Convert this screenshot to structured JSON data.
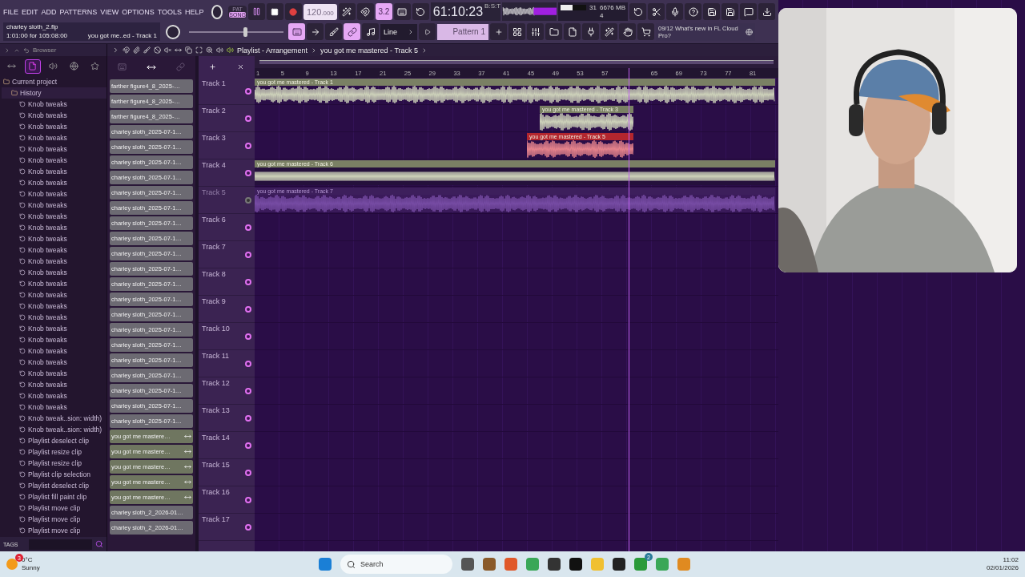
{
  "menu": [
    "FILE",
    "EDIT",
    "ADD",
    "PATTERNS",
    "VIEW",
    "OPTIONS",
    "TOOLS",
    "HELP"
  ],
  "hint": {
    "file": "charley sloth_2.flp",
    "time": "1:01:00 for 105:08:00",
    "clip": "you got me..ed - Track 1"
  },
  "mode_switch": [
    {
      "label": "PAT",
      "selected": false
    },
    {
      "label": "SONG",
      "selected": true
    }
  ],
  "tempo": {
    "value": "120",
    "decimals": ".000"
  },
  "tool_buttons_1": [
    {
      "on": false
    },
    {
      "on": false
    },
    {
      "on": true,
      "label": "3.2"
    },
    {
      "on": false
    },
    {
      "on": false
    }
  ],
  "tool_buttons_2": [
    {
      "on": true
    },
    {
      "on": false
    },
    {
      "on": false
    },
    {
      "on": true
    },
    {
      "on": false
    }
  ],
  "master": {
    "level": 0.6
  },
  "snap": "Line",
  "pattern": "Pattern 1",
  "clock": {
    "time": "61:10:23",
    "unit": "B:S:T"
  },
  "meters": {
    "cpu": "31",
    "memory": "6676 MB",
    "voices": "4",
    "level": 0.45
  },
  "news": {
    "date": "09/12",
    "text": "What's new in FL Cloud Pro?"
  },
  "browser": {
    "title": "Browser",
    "tabs": [
      {
        "selected": false
      },
      {
        "selected": true
      },
      {
        "selected": false
      },
      {
        "selected": false
      },
      {
        "selected": false
      }
    ],
    "tree": [
      {
        "label": "Current project",
        "children": [
          {
            "label": "History",
            "children": [
              {
                "label": "Knob tweaks"
              },
              {
                "label": "Knob tweaks"
              },
              {
                "label": "Knob tweaks"
              },
              {
                "label": "Knob tweaks"
              },
              {
                "label": "Knob tweaks"
              },
              {
                "label": "Knob tweaks"
              },
              {
                "label": "Knob tweaks"
              },
              {
                "label": "Knob tweaks"
              },
              {
                "label": "Knob tweaks"
              },
              {
                "label": "Knob tweaks"
              },
              {
                "label": "Knob tweaks"
              },
              {
                "label": "Knob tweaks"
              },
              {
                "label": "Knob tweaks"
              },
              {
                "label": "Knob tweaks"
              },
              {
                "label": "Knob tweaks"
              },
              {
                "label": "Knob tweaks"
              },
              {
                "label": "Knob tweaks"
              },
              {
                "label": "Knob tweaks"
              },
              {
                "label": "Knob tweaks"
              },
              {
                "label": "Knob tweaks"
              },
              {
                "label": "Knob tweaks"
              },
              {
                "label": "Knob tweaks"
              },
              {
                "label": "Knob tweaks"
              },
              {
                "label": "Knob tweaks"
              },
              {
                "label": "Knob tweaks"
              },
              {
                "label": "Knob tweaks"
              },
              {
                "label": "Knob tweaks"
              },
              {
                "label": "Knob tweaks"
              },
              {
                "label": "Knob tweak..sion: width)"
              },
              {
                "label": "Knob tweak..sion: width)"
              },
              {
                "label": "Playlist deselect clip"
              },
              {
                "label": "Playlist resize clip"
              },
              {
                "label": "Playlist resize clip"
              },
              {
                "label": "Playlist clip selection"
              },
              {
                "label": "Playlist deselect clip"
              },
              {
                "label": "Playlist fill paint clip"
              },
              {
                "label": "Playlist move clip"
              },
              {
                "label": "Playlist move clip"
              },
              {
                "label": "Playlist move clip"
              }
            ]
          }
        ]
      }
    ],
    "tags": "TAGS"
  },
  "playlist": {
    "title": "Playlist - Arrangement",
    "path": "you got me mastered - Track 5",
    "picker_tabs": [
      {
        "selected": false
      },
      {
        "selected": true
      },
      {
        "selected": false
      }
    ],
    "picker": [
      {
        "label": "farther figure4_8_2025-…",
        "kind": "sample"
      },
      {
        "label": "farther figure4_8_2025-…",
        "kind": "sample"
      },
      {
        "label": "farther figure4_8_2025-…",
        "kind": "sample"
      },
      {
        "label": "charley sloth_2025-07-1…",
        "kind": "sample"
      },
      {
        "label": "charley sloth_2025-07-1…",
        "kind": "sample"
      },
      {
        "label": "charley sloth_2025-07-1…",
        "kind": "sample"
      },
      {
        "label": "charley sloth_2025-07-1…",
        "kind": "sample"
      },
      {
        "label": "charley sloth_2025-07-1…",
        "kind": "sample"
      },
      {
        "label": "charley sloth_2025-07-1…",
        "kind": "sample"
      },
      {
        "label": "charley sloth_2025-07-1…",
        "kind": "sample"
      },
      {
        "label": "charley sloth_2025-07-1…",
        "kind": "sample"
      },
      {
        "label": "charley sloth_2025-07-1…",
        "kind": "sample"
      },
      {
        "label": "charley sloth_2025-07-1…",
        "kind": "sample"
      },
      {
        "label": "charley sloth_2025-07-1…",
        "kind": "sample"
      },
      {
        "label": "charley sloth_2025-07-1…",
        "kind": "sample"
      },
      {
        "label": "charley sloth_2025-07-1…",
        "kind": "sample"
      },
      {
        "label": "charley sloth_2025-07-1…",
        "kind": "sample"
      },
      {
        "label": "charley sloth_2025-07-1…",
        "kind": "sample"
      },
      {
        "label": "charley sloth_2025-07-1…",
        "kind": "sample"
      },
      {
        "label": "charley sloth_2025-07-1…",
        "kind": "sample"
      },
      {
        "label": "charley sloth_2025-07-1…",
        "kind": "sample"
      },
      {
        "label": "charley sloth_2025-07-1…",
        "kind": "sample"
      },
      {
        "label": "charley sloth_2025-07-1…",
        "kind": "sample"
      },
      {
        "label": "you got me mastere…",
        "kind": "clip"
      },
      {
        "label": "you got me mastere…",
        "kind": "clip"
      },
      {
        "label": "you got me mastere…",
        "kind": "clip"
      },
      {
        "label": "you got me mastere…",
        "kind": "clip"
      },
      {
        "label": "you got me mastere…",
        "kind": "clip"
      },
      {
        "label": "charley sloth_2_2026-01…",
        "kind": "sample"
      },
      {
        "label": "charley sloth_2_2026-01…",
        "kind": "sample"
      }
    ],
    "ruler": [
      "1",
      "5",
      "9",
      "13",
      "17",
      "21",
      "25",
      "29",
      "33",
      "37",
      "41",
      "45",
      "49",
      "53",
      "57",
      "65",
      "69",
      "73",
      "77",
      "81"
    ],
    "tracks": [
      {
        "label": "Track 1",
        "enabled": true,
        "clips": [
          {
            "label": "you got me mastered - Track 1",
            "color": "#7a8064",
            "muted": false
          }
        ]
      },
      {
        "label": "Track 2",
        "enabled": true,
        "clips": [
          {
            "label": "you got me mastered - Track 3",
            "color": "#7a8064",
            "muted": false
          }
        ]
      },
      {
        "label": "Track 3",
        "enabled": true,
        "clips": [
          {
            "label": "you got me mastered - Track 5",
            "color": "#b3262e",
            "muted": false
          }
        ]
      },
      {
        "label": "Track 4",
        "enabled": true,
        "clips": [
          {
            "label": "you got me mastered - Track 6",
            "color": "#7a8064",
            "muted": false
          }
        ]
      },
      {
        "label": "Track 5",
        "enabled": false,
        "clips": [
          {
            "label": "you got me mastered - Track 7",
            "muted": true
          }
        ]
      },
      {
        "label": "Track 6",
        "enabled": true
      },
      {
        "label": "Track 7",
        "enabled": true
      },
      {
        "label": "Track 8",
        "enabled": true
      },
      {
        "label": "Track 9",
        "enabled": true
      },
      {
        "label": "Track 10",
        "enabled": true
      },
      {
        "label": "Track 11",
        "enabled": true
      },
      {
        "label": "Track 12",
        "enabled": true
      },
      {
        "label": "Track 13",
        "enabled": true
      },
      {
        "label": "Track 14",
        "enabled": true
      },
      {
        "label": "Track 15",
        "enabled": true
      },
      {
        "label": "Track 16",
        "enabled": true
      },
      {
        "label": "Track 17",
        "enabled": true
      }
    ]
  },
  "taskbar": {
    "weather": {
      "temp": "0°C",
      "text": "Sunny",
      "badge": "3"
    },
    "search": "Search",
    "xbox_badge": "2",
    "time": "11:02",
    "date": "02/01/2026"
  }
}
